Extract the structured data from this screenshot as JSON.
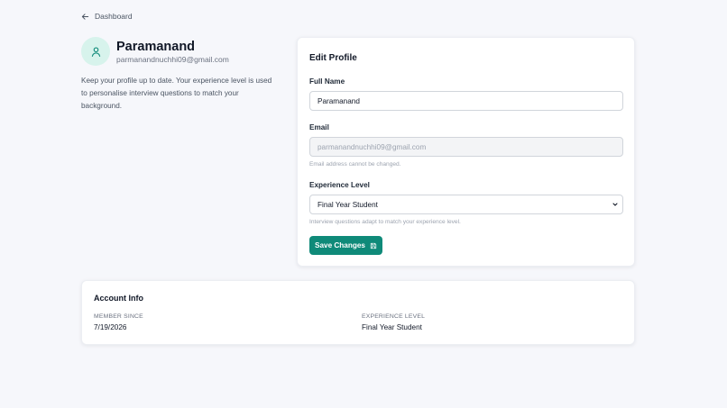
{
  "nav": {
    "back_label": "Dashboard"
  },
  "profile": {
    "name": "Paramanand",
    "email": "parmanandnuchhi09@gmail.com",
    "intro": "Keep your profile up to date. Your experience level is used to personalise interview questions to match your background."
  },
  "edit_profile": {
    "title": "Edit Profile",
    "full_name_label": "Full Name",
    "full_name_value": "Paramanand",
    "email_label": "Email",
    "email_value": "parmanandnuchhi09@gmail.com",
    "email_hint": "Email address cannot be changed.",
    "experience_label": "Experience Level",
    "experience_value": "Final Year Student",
    "experience_hint": "Interview questions adapt to match your experience level.",
    "save_label": "Save Changes"
  },
  "account_info": {
    "title": "Account Info",
    "member_since_label": "Member Since",
    "member_since_value": "7/19/2026",
    "experience_level_label": "Experience Level",
    "experience_level_value": "Final Year Student"
  },
  "colors": {
    "accent": "#0f8a79",
    "avatar_bg": "#d7f3ec",
    "page_bg": "#f6f7fb"
  },
  "icons": {
    "back": "arrow-left-icon",
    "avatar": "user-icon",
    "select": "chevron-down-icon",
    "save": "save-icon"
  }
}
